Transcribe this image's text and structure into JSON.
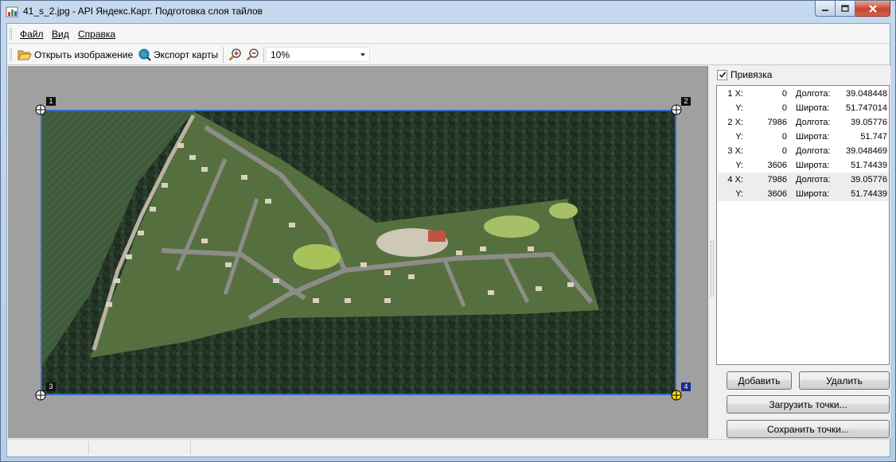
{
  "window": {
    "title": "41_s_2.jpg - API Яндекс.Карт. Подготовка слоя тайлов"
  },
  "menu": {
    "items": [
      {
        "label": "Файл"
      },
      {
        "label": "Вид"
      },
      {
        "label": "Справка"
      }
    ]
  },
  "toolbar": {
    "open_label": "Открыть изображение",
    "export_label": "Экспорт карты",
    "zoom_value": "10%"
  },
  "markers": [
    {
      "label": "1",
      "active": false
    },
    {
      "label": "2",
      "active": false
    },
    {
      "label": "3",
      "active": false
    },
    {
      "label": "4",
      "active": true
    }
  ],
  "panel": {
    "snap_label": "Привязка",
    "snap_checked": true,
    "points": [
      {
        "key": "1 X:",
        "value": "0",
        "geo_label": "Долгота:",
        "geo_value": "39.048448",
        "selected": false
      },
      {
        "key": "Y:",
        "value": "0",
        "geo_label": "Широта:",
        "geo_value": "51.747014",
        "selected": false
      },
      {
        "key": "2 X:",
        "value": "7986",
        "geo_label": "Долгота:",
        "geo_value": "39.05776",
        "selected": false
      },
      {
        "key": "Y:",
        "value": "0",
        "geo_label": "Широта:",
        "geo_value": "51.747",
        "selected": false
      },
      {
        "key": "3 X:",
        "value": "0",
        "geo_label": "Долгота:",
        "geo_value": "39.048469",
        "selected": false
      },
      {
        "key": "Y:",
        "value": "3606",
        "geo_label": "Широта:",
        "geo_value": "51.74439",
        "selected": false
      },
      {
        "key": "4 X:",
        "value": "7986",
        "geo_label": "Долгота:",
        "geo_value": "39.05776",
        "selected": true
      },
      {
        "key": "Y:",
        "value": "3606",
        "geo_label": "Широта:",
        "geo_value": "51.74439",
        "selected": true
      }
    ],
    "add_label": "Добавить",
    "delete_label": "Удалить",
    "load_label": "Загрузить точки...",
    "save_label": "Сохранить точки..."
  },
  "colors": {
    "selection_border": "#2f6ec9",
    "active_marker": "#ffe000"
  }
}
